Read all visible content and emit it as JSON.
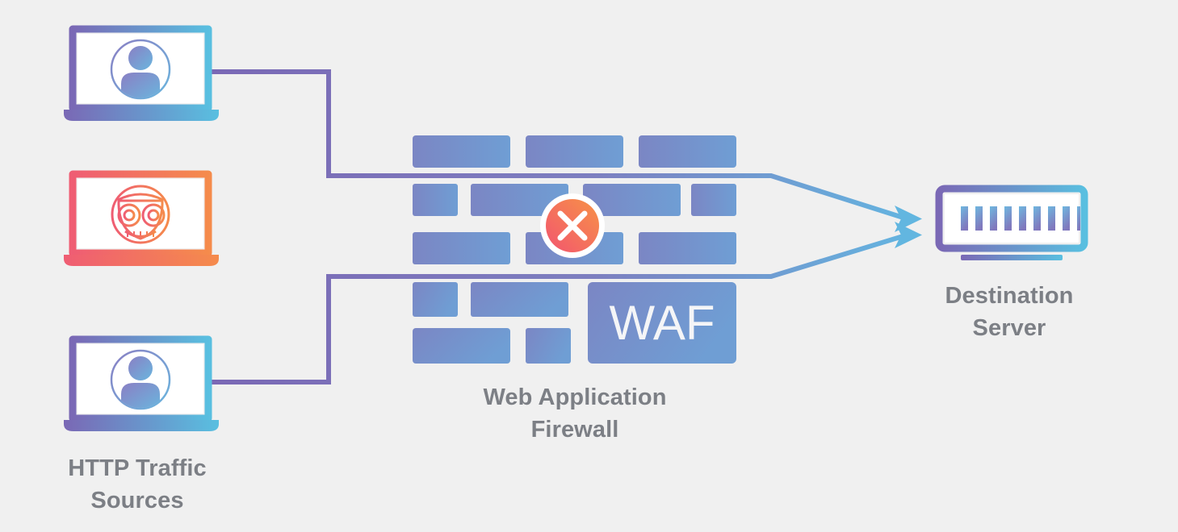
{
  "diagram": {
    "title": "Web Application Firewall traffic flow",
    "background_color": "#f0f0f0",
    "labels": {
      "sources": "HTTP Traffic\nSources",
      "firewall": "Web Application\nFirewall",
      "server": "Destination\nServer",
      "label_color": "#7c7f85"
    },
    "firewall": {
      "brick_label": "WAF",
      "brick_label_color": "#f4f5f7",
      "brick_color_left": "#7b86c4",
      "brick_color_right": "#6f9ed4",
      "block_marker": {
        "icon": "x-circle-icon",
        "glyph": "✕",
        "color_start": "#f2646e",
        "color_end": "#f4944a",
        "ring_color": "#ffffff"
      }
    },
    "nodes": [
      {
        "id": "user-top",
        "icon": "laptop-user-icon",
        "kind": "legitimate-user",
        "status": "allowed",
        "color_start": "#7a68b5",
        "color_end": "#59bfe0"
      },
      {
        "id": "bot-middle",
        "icon": "laptop-bot-icon",
        "kind": "malicious-bot",
        "status": "blocked",
        "color_start": "#ef5d73",
        "color_end": "#f58b4c"
      },
      {
        "id": "user-bottom",
        "icon": "laptop-user-icon",
        "kind": "legitimate-user",
        "status": "allowed",
        "color_start": "#7a68b5",
        "color_end": "#59bfe0"
      },
      {
        "id": "destination-server",
        "icon": "server-rack-icon",
        "kind": "server",
        "bar_count": 9,
        "color_start": "#7a68b5",
        "color_end": "#59bfe0"
      }
    ],
    "connections": [
      {
        "id": "conn-user-top",
        "from": "user-top",
        "to": "destination-server",
        "state": "allowed",
        "color_start": "#7a68b5",
        "color_end": "#62b6e0"
      },
      {
        "id": "conn-bot-middle",
        "from": "bot-middle",
        "to": "firewall",
        "state": "blocked",
        "color_start": "#ef5d73",
        "color_end": "#f58b4c"
      },
      {
        "id": "conn-user-bottom",
        "from": "user-bottom",
        "to": "destination-server",
        "state": "allowed",
        "color_start": "#7a68b5",
        "color_end": "#62b6e0"
      }
    ]
  }
}
